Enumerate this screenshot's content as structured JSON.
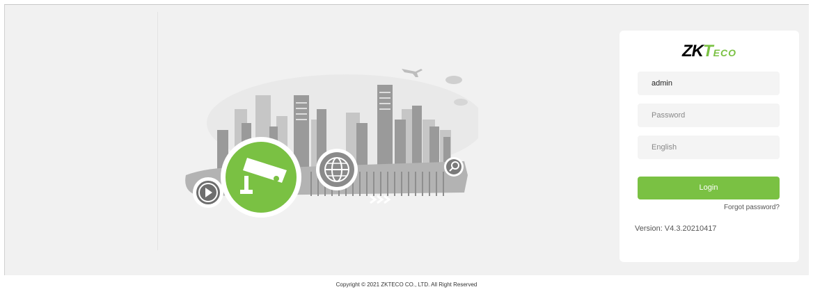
{
  "brand": {
    "logo_zk": "ZK",
    "logo_t": "T",
    "logo_eco": "ECO"
  },
  "login": {
    "username_value": "admin",
    "password_placeholder": "Password",
    "language_value": "English",
    "login_label": "Login",
    "forgot_label": "Forgot password?",
    "version_text": "Version: V4.3.20210417"
  },
  "footer": {
    "copyright": "Copyright © 2021 ZKTECO CO., LTD. All Right Reserved"
  },
  "colors": {
    "accent": "#7ac143",
    "background": "#f1f1f1",
    "card": "#ffffff"
  },
  "illustration": {
    "icons": [
      "camera-icon",
      "play-icon",
      "globe-icon",
      "search-icon",
      "airplane-icon"
    ]
  }
}
